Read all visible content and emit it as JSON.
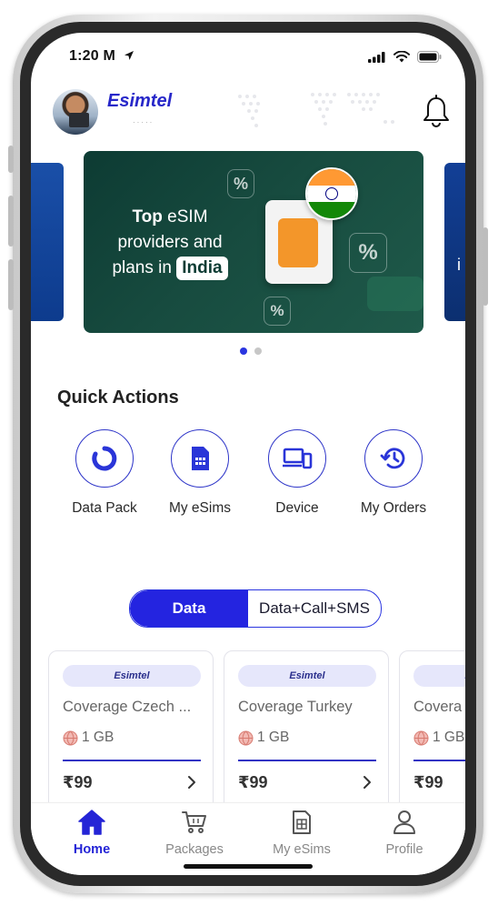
{
  "status": {
    "time": "1:20 M"
  },
  "header": {
    "brand": "Esimtel"
  },
  "banner": {
    "line1_bold": "Top",
    "line1_rest": " eSIM",
    "line2": "providers and",
    "line3": "plans in",
    "country": "India",
    "percent_symbol": "%",
    "peek_right_text": "i"
  },
  "carousel": {
    "total": 2,
    "active": 0
  },
  "quick_actions": {
    "title": "Quick Actions",
    "items": [
      {
        "label": "Data Pack",
        "icon": "data-pack-icon"
      },
      {
        "label": "My eSims",
        "icon": "sim-card-icon"
      },
      {
        "label": "Device",
        "icon": "device-icon"
      },
      {
        "label": "My Orders",
        "icon": "order-history-icon"
      }
    ]
  },
  "plan_toggle": {
    "options": [
      "Data",
      "Data+Call+SMS"
    ],
    "selected": "Data"
  },
  "packages": [
    {
      "brand": "Esimtel",
      "coverage": "Coverage Czech ...",
      "data": "1 GB",
      "price": "₹99"
    },
    {
      "brand": "Esimtel",
      "coverage": "Coverage Turkey",
      "data": "1 GB",
      "price": "₹99"
    },
    {
      "brand": "Esimtel",
      "coverage": "Covera",
      "data": "1 GB",
      "price": "₹99"
    }
  ],
  "tabbar": {
    "items": [
      {
        "label": "Home",
        "icon": "home-icon",
        "active": true
      },
      {
        "label": "Packages",
        "icon": "cart-icon",
        "active": false
      },
      {
        "label": "My eSims",
        "icon": "sim-card-icon",
        "active": false
      },
      {
        "label": "Profile",
        "icon": "profile-icon",
        "active": false
      }
    ]
  },
  "colors": {
    "accent": "#2424E0",
    "banner_bg": "#174B3F",
    "text": "#222222",
    "muted": "#666666"
  }
}
